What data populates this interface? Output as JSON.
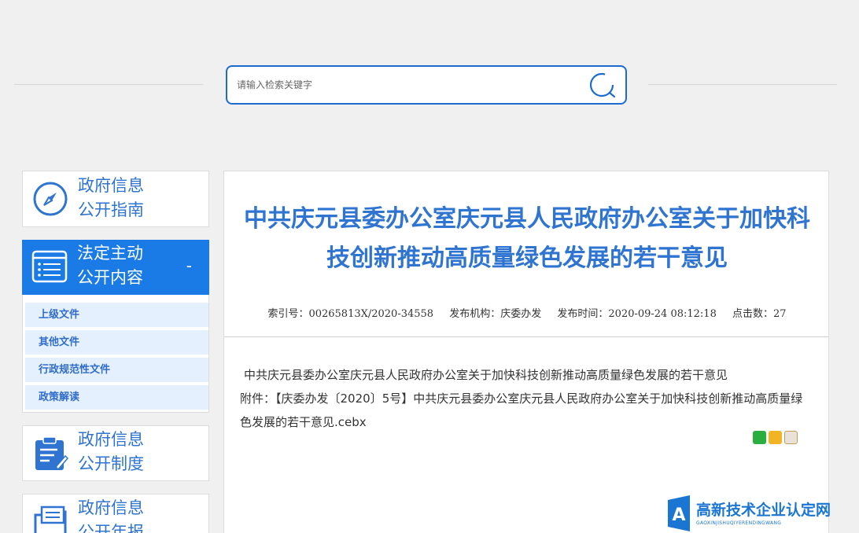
{
  "search": {
    "placeholder": "请输入检索关键字",
    "icon": "search-icon"
  },
  "sidebar": {
    "guide": {
      "line1": "政府信息",
      "line2": "公开指南",
      "icon": "compass-icon"
    },
    "content": {
      "line1": "法定主动",
      "line2": "公开内容",
      "toggle": "-",
      "icon": "list-icon",
      "items": [
        {
          "label": "上级文件"
        },
        {
          "label": "其他文件"
        },
        {
          "label": "行政规范性文件"
        },
        {
          "label": "政策解读"
        }
      ]
    },
    "system": {
      "line1": "政府信息",
      "line2": "公开制度",
      "icon": "clipboard-icon"
    },
    "report": {
      "line1": "政府信息",
      "line2": "公开年报",
      "icon": "folder-icon"
    }
  },
  "article": {
    "title": "中共庆元县委办公室庆元县人民政府办公室关于加快科技创新推动高质量绿色发展的若干意见",
    "meta": {
      "index": "索引号：00265813X/2020-34558",
      "publisher": "发布机构：庆委办发",
      "time": "发布时间：2020-09-24 08:12:18",
      "clicks": "点击数：27"
    },
    "body_line1": "中共庆元县委办公室庆元县人民政府办公室关于加快科技创新推动高质量绿色发展的若干意见",
    "attachment_label": "附件：",
    "attachment_link": "【庆委办发〔2020〕5号】中共庆元县委办公室庆元县人民政府办公室关于加快科技创新推动高质量绿色发展的若干意见.cebx",
    "share": [
      "wechat-icon",
      "qzone-icon",
      "weibo-icon"
    ]
  },
  "watermark": {
    "text": "高新技术企业认定网",
    "sub": "GAOXINJISHUQIYERENDINGWANG"
  },
  "colors": {
    "accent": "#2f74d0",
    "sidebar_active": "#1a7be6",
    "sub_item_bg": "#e4f0fd"
  }
}
